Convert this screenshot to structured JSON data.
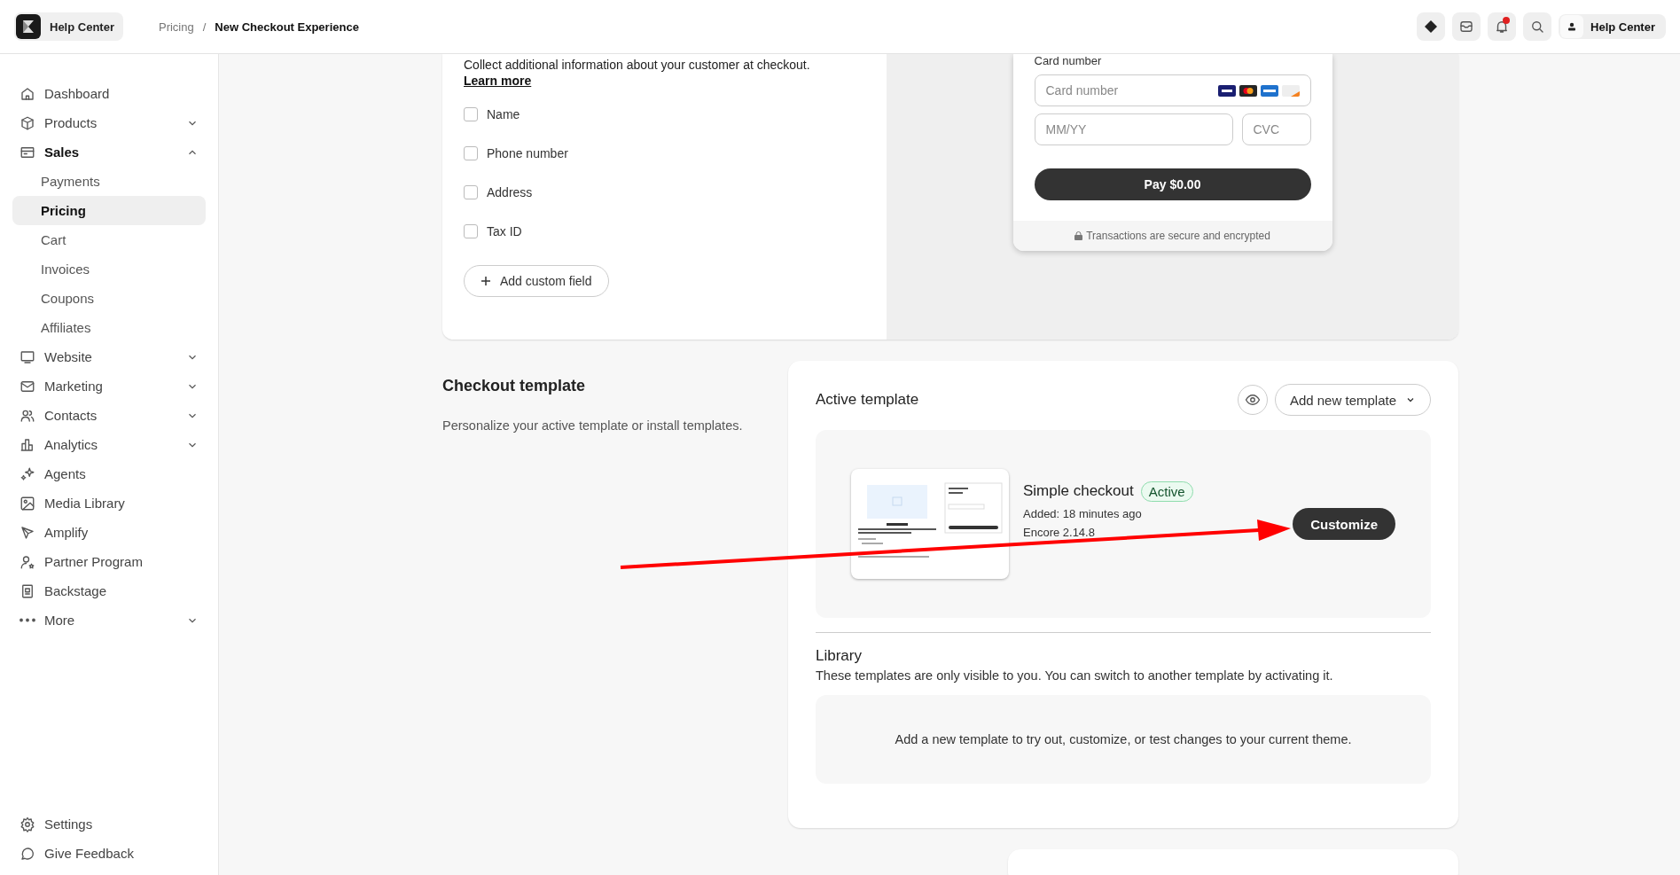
{
  "header": {
    "brand": "Help Center",
    "breadcrumb": [
      {
        "label": "Pricing",
        "current": false
      },
      {
        "label": "New Checkout Experience",
        "current": true
      }
    ],
    "separator": "/",
    "notifications_unread": true,
    "account": "Help Center"
  },
  "sidebar": {
    "items": [
      {
        "label": "Dashboard",
        "selected": false
      },
      {
        "label": "Products",
        "selected": false,
        "expanded": false
      },
      {
        "label": "Sales",
        "selected": false,
        "expanded": true,
        "children": [
          {
            "label": "Payments",
            "selected": false
          },
          {
            "label": "Pricing",
            "selected": true
          },
          {
            "label": "Cart",
            "selected": false
          },
          {
            "label": "Invoices",
            "selected": false
          },
          {
            "label": "Coupons",
            "selected": false
          },
          {
            "label": "Affiliates",
            "selected": false
          }
        ]
      },
      {
        "label": "Website",
        "selected": false,
        "expanded": false
      },
      {
        "label": "Marketing",
        "selected": false,
        "expanded": false
      },
      {
        "label": "Contacts",
        "selected": false,
        "expanded": false
      },
      {
        "label": "Analytics",
        "selected": false,
        "expanded": false
      },
      {
        "label": "Agents",
        "selected": false
      },
      {
        "label": "Media Library",
        "selected": false
      },
      {
        "label": "Amplify",
        "selected": false
      },
      {
        "label": "Partner Program",
        "selected": false
      },
      {
        "label": "Backstage",
        "selected": false
      },
      {
        "label": "More",
        "selected": false,
        "expanded": false
      }
    ],
    "footer": [
      {
        "label": "Settings"
      },
      {
        "label": "Give Feedback"
      }
    ]
  },
  "checkout_fields": {
    "intro": "Collect additional information about your customer at checkout.",
    "link": "Learn more",
    "fields": [
      {
        "label": "Name",
        "checked": false
      },
      {
        "label": "Phone number",
        "checked": false
      },
      {
        "label": "Address",
        "checked": false
      },
      {
        "label": "Tax ID",
        "checked": false
      }
    ],
    "add_button": "Add custom field"
  },
  "preview": {
    "card_label": "Card number",
    "card_placeholder": "Card number",
    "expiry_placeholder": "MM/YY",
    "cvc_placeholder": "CVC",
    "pay_button": "Pay $0.00",
    "secure_note": "Transactions are secure and encrypted"
  },
  "checkout_template": {
    "title": "Checkout template",
    "description": "Personalize your active template or install templates.",
    "active_title": "Active template",
    "add_button": "Add new template",
    "template": {
      "name": "Simple checkout",
      "active": true,
      "badge": "Active",
      "added": "Added: 18 minutes ago",
      "version": "Encore 2.14.8",
      "button": "Customize"
    },
    "library_title": "Library",
    "library_description": "These templates are only visible to you. You can switch to another template by activating it.",
    "library_empty": "Add a new template to try out, customize, or test changes to your current theme."
  }
}
